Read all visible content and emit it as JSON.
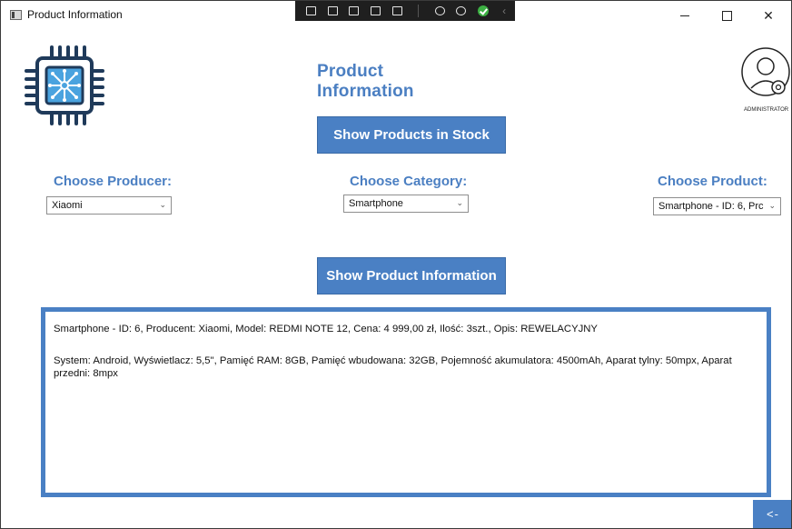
{
  "window": {
    "title": "Product Information",
    "controls": {
      "minimize": "—",
      "maximize": "☐",
      "close": "✕"
    }
  },
  "debug_toolbar": {
    "icons": [
      "select-element-icon",
      "preview-icon",
      "track-focus-icon",
      "layout-adorner-icon",
      "hot-reload-icon",
      "accessibility-icon",
      "binding-failures-icon",
      "ok-status-icon",
      "collapse-icon"
    ]
  },
  "header": {
    "page_title": "Product Information",
    "admin_label": "ADMINISTRATOR"
  },
  "buttons": {
    "show_stock": "Show Products in Stock",
    "show_info": "Show Product Information",
    "back": "<-"
  },
  "filters": {
    "producer": {
      "label": "Choose Producer:",
      "value": "Xiaomi"
    },
    "category": {
      "label": "Choose Category:",
      "value": "Smartphone"
    },
    "product": {
      "label": "Choose Product:",
      "value": "Smartphone - ID: 6, Prc"
    }
  },
  "info": {
    "line1": "Smartphone - ID: 6, Producent: Xiaomi, Model: REDMI NOTE 12, Cena: 4 999,00 zł, Ilość: 3szt., Opis: REWELACYJNY",
    "line2": "System: Android, Wyświetlacz: 5,5\", Pamięć RAM: 8GB, Pamięć wbudowana: 32GB, Pojemność akumulatora: 4500mAh, Aparat tylny: 50mpx, Aparat przedni: 8mpx"
  },
  "colors": {
    "accent": "#4a80c4",
    "title_blue": "#4b7fc2",
    "chip_dark": "#1f3a5a",
    "chip_light": "#4aa3df"
  }
}
